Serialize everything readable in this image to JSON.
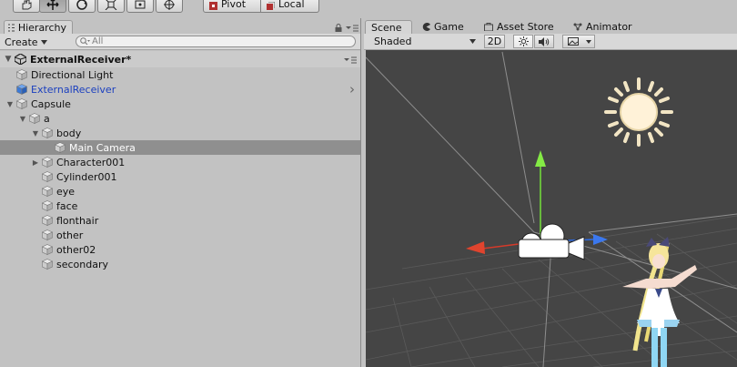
{
  "toolbar": {
    "pivot_label": "Pivot",
    "local_label": "Local"
  },
  "hierarchy": {
    "tab_label": "Hierarchy",
    "create_label": "Create",
    "search_placeholder": "All",
    "scene_name": "ExternalReceiver*",
    "items": [
      {
        "label": "Directional Light",
        "depth": 1,
        "expander": "none",
        "selected": false,
        "color": "#111111"
      },
      {
        "label": "ExternalReceiver",
        "depth": 1,
        "expander": "none",
        "selected": false,
        "color": "#1a3fbf",
        "has_child_arrow": true
      },
      {
        "label": "Capsule",
        "depth": 1,
        "expander": "open",
        "selected": false,
        "color": "#111111"
      },
      {
        "label": "a",
        "depth": 2,
        "expander": "open",
        "selected": false,
        "color": "#111111"
      },
      {
        "label": "body",
        "depth": 3,
        "expander": "open",
        "selected": false,
        "color": "#111111"
      },
      {
        "label": "Main Camera",
        "depth": 4,
        "expander": "none",
        "selected": true,
        "color": "#ffffff"
      },
      {
        "label": "Character001",
        "depth": 3,
        "expander": "closed",
        "selected": false,
        "color": "#111111"
      },
      {
        "label": "Cylinder001",
        "depth": 3,
        "expander": "none",
        "selected": false,
        "color": "#111111"
      },
      {
        "label": "eye",
        "depth": 3,
        "expander": "none",
        "selected": false,
        "color": "#111111"
      },
      {
        "label": "face",
        "depth": 3,
        "expander": "none",
        "selected": false,
        "color": "#111111"
      },
      {
        "label": "flonthair",
        "depth": 3,
        "expander": "none",
        "selected": false,
        "color": "#111111"
      },
      {
        "label": "other",
        "depth": 3,
        "expander": "none",
        "selected": false,
        "color": "#111111"
      },
      {
        "label": "other02",
        "depth": 3,
        "expander": "none",
        "selected": false,
        "color": "#111111"
      },
      {
        "label": "secondary",
        "depth": 3,
        "expander": "none",
        "selected": false,
        "color": "#111111"
      }
    ]
  },
  "scene": {
    "tabs": [
      {
        "label": "Scene",
        "icon": "grid-icon",
        "active": true
      },
      {
        "label": "Game",
        "icon": "pacman-icon",
        "active": false
      },
      {
        "label": "Asset Store",
        "icon": "store-icon",
        "active": false
      },
      {
        "label": "Animator",
        "icon": "animator-icon",
        "active": false
      }
    ],
    "shading_mode": "Shaded",
    "mode_2d_label": "2D"
  }
}
